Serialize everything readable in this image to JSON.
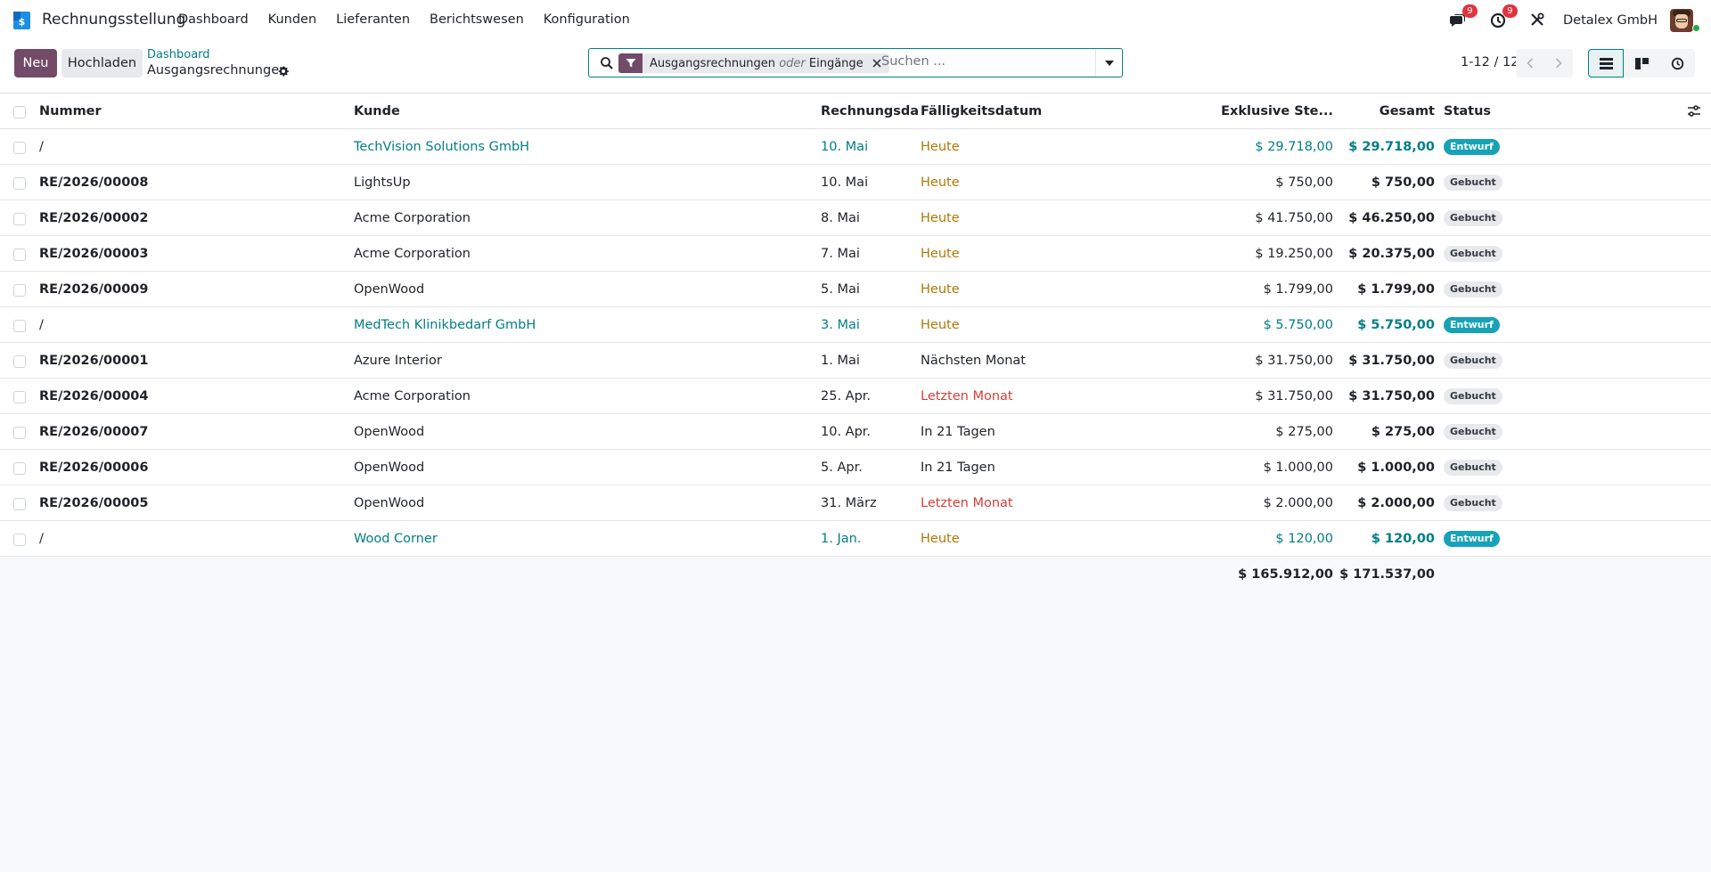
{
  "app": {
    "name": "Rechnungsstellung",
    "menu": [
      "Dashboard",
      "Kunden",
      "Lieferanten",
      "Berichtswesen",
      "Konfiguration"
    ],
    "messages_badge": "9",
    "activities_badge": "9",
    "company": "Detalex GmbH",
    "accent_color": "#714b67",
    "link_color": "#017e84"
  },
  "control": {
    "new_label": "Neu",
    "upload_label": "Hochladen",
    "breadcrumb_parent": "Dashboard",
    "breadcrumb_current": "Ausgangsrechnungen",
    "facet_part1": "Ausgangsrechnungen",
    "facet_or": "oder",
    "facet_part2": "Eingänge",
    "search_placeholder": "Suchen ...",
    "pager": "1-12 / 12"
  },
  "table": {
    "headers": {
      "number": "Nummer",
      "customer": "Kunde",
      "invoice_date": "Rechnungsda...",
      "due_date": "Fälligkeitsdatum",
      "untaxed": "Exklusive Ste...",
      "total": "Gesamt",
      "status": "Status"
    },
    "rows": [
      {
        "number": "/",
        "customer": "TechVision Solutions GmbH",
        "invoice_date": "10. Mai",
        "due_date": "Heute",
        "due_state": "warn",
        "untaxed": "$ 29.718,00",
        "total": "$ 29.718,00",
        "status": "Entwurf",
        "draft": true
      },
      {
        "number": "RE/2026/00008",
        "customer": "LightsUp",
        "invoice_date": "10. Mai",
        "due_date": "Heute",
        "due_state": "warn",
        "untaxed": "$ 750,00",
        "total": "$ 750,00",
        "status": "Gebucht",
        "draft": false
      },
      {
        "number": "RE/2026/00002",
        "customer": "Acme Corporation",
        "invoice_date": "8. Mai",
        "due_date": "Heute",
        "due_state": "warn",
        "untaxed": "$ 41.750,00",
        "total": "$ 46.250,00",
        "status": "Gebucht",
        "draft": false
      },
      {
        "number": "RE/2026/00003",
        "customer": "Acme Corporation",
        "invoice_date": "7. Mai",
        "due_date": "Heute",
        "due_state": "warn",
        "untaxed": "$ 19.250,00",
        "total": "$ 20.375,00",
        "status": "Gebucht",
        "draft": false
      },
      {
        "number": "RE/2026/00009",
        "customer": "OpenWood",
        "invoice_date": "5. Mai",
        "due_date": "Heute",
        "due_state": "warn",
        "untaxed": "$ 1.799,00",
        "total": "$ 1.799,00",
        "status": "Gebucht",
        "draft": false
      },
      {
        "number": "/",
        "customer": "MedTech Klinikbedarf GmbH",
        "invoice_date": "3. Mai",
        "due_date": "Heute",
        "due_state": "warn",
        "untaxed": "$ 5.750,00",
        "total": "$ 5.750,00",
        "status": "Entwurf",
        "draft": true
      },
      {
        "number": "RE/2026/00001",
        "customer": "Azure Interior",
        "invoice_date": "1. Mai",
        "due_date": "Nächsten Monat",
        "due_state": "normal",
        "untaxed": "$ 31.750,00",
        "total": "$ 31.750,00",
        "status": "Gebucht",
        "draft": false
      },
      {
        "number": "RE/2026/00004",
        "customer": "Acme Corporation",
        "invoice_date": "25. Apr.",
        "due_date": "Letzten Monat",
        "due_state": "danger",
        "untaxed": "$ 31.750,00",
        "total": "$ 31.750,00",
        "status": "Gebucht",
        "draft": false
      },
      {
        "number": "RE/2026/00007",
        "customer": "OpenWood",
        "invoice_date": "10. Apr.",
        "due_date": "In 21 Tagen",
        "due_state": "normal",
        "untaxed": "$ 275,00",
        "total": "$ 275,00",
        "status": "Gebucht",
        "draft": false
      },
      {
        "number": "RE/2026/00006",
        "customer": "OpenWood",
        "invoice_date": "5. Apr.",
        "due_date": "In 21 Tagen",
        "due_state": "normal",
        "untaxed": "$ 1.000,00",
        "total": "$ 1.000,00",
        "status": "Gebucht",
        "draft": false
      },
      {
        "number": "RE/2026/00005",
        "customer": "OpenWood",
        "invoice_date": "31. März",
        "due_date": "Letzten Monat",
        "due_state": "danger",
        "untaxed": "$ 2.000,00",
        "total": "$ 2.000,00",
        "status": "Gebucht",
        "draft": false
      },
      {
        "number": "/",
        "customer": "Wood Corner",
        "invoice_date": "1. Jan.",
        "due_date": "Heute",
        "due_state": "warn",
        "untaxed": "$ 120,00",
        "total": "$ 120,00",
        "status": "Entwurf",
        "draft": true
      }
    ],
    "totals": {
      "untaxed": "$ 165.912,00",
      "total": "$ 171.537,00"
    }
  }
}
